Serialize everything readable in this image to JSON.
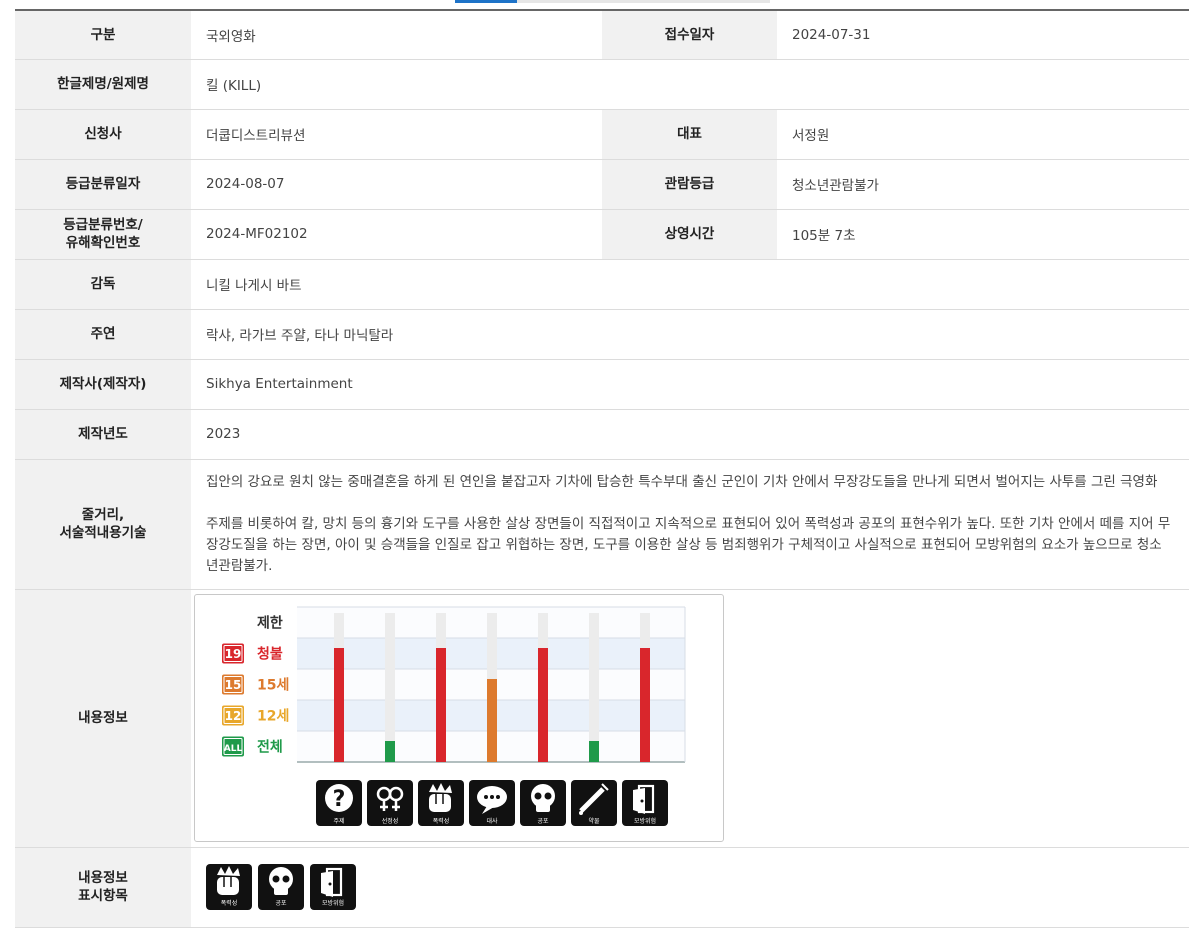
{
  "rows": {
    "category": {
      "label": "구분",
      "value": "국외영화"
    },
    "received": {
      "label": "접수일자",
      "value": "2024-07-31"
    },
    "title": {
      "label": "한글제명/원제명",
      "value": "킬 (KILL)"
    },
    "applicant": {
      "label": "신청사",
      "value": "더쿱디스트리뷰션"
    },
    "representative": {
      "label": "대표",
      "value": "서정원"
    },
    "rating_date": {
      "label": "등급분류일자",
      "value": "2024-08-07"
    },
    "rating": {
      "label": "관람등급",
      "value": "청소년관람불가"
    },
    "rating_no": {
      "label_line1": "등급분류번호/",
      "label_line2": "유해확인번호",
      "value": "2024-MF02102"
    },
    "runtime": {
      "label": "상영시간",
      "value": "105분 7초"
    },
    "director": {
      "label": "감독",
      "value": "니킬 나게시 바트"
    },
    "cast": {
      "label": "주연",
      "value": "락샤, 라가브 주얄, 타나 마닉탈라"
    },
    "producer": {
      "label": "제작사(제작자)",
      "value": "Sikhya Entertainment"
    },
    "year": {
      "label": "제작년도",
      "value": "2023"
    },
    "synopsis": {
      "label_line1": "줄거리,",
      "label_line2": "서술적내용기술",
      "para1": "집안의 강요로 원치 않는 중매결혼을 하게 된 연인을 붙잡고자 기차에 탑승한 특수부대 출신 군인이 기차 안에서 무장강도들을 만나게 되면서 벌어지는 사투를 그린 극영화",
      "para2": "주제를 비롯하여 칼, 망치 등의 흉기와 도구를 사용한 살상 장면들이 직접적이고 지속적으로 표현되어 있어 폭력성과 공포의 표현수위가 높다. 또한 기차 안에서 떼를 지어 무장강도질을 하는 장면, 아이 및 승객들을 인질로 잡고 위협하는 장면, 도구를 이용한 살상 등 범죄행위가 구체적이고 사실적으로 표현되어 모방위험의 요소가 높으므로 청소년관람불가."
    },
    "content_info": {
      "label": "내용정보"
    },
    "display_items": {
      "label_line1": "내용정보",
      "label_line2": "표시항목"
    }
  },
  "levels": [
    {
      "badge": "",
      "name": "제한",
      "color": "#333333"
    },
    {
      "badge": "19",
      "name": "청불",
      "color": "#d9262c"
    },
    {
      "badge": "15",
      "name": "15세",
      "color": "#dd7a2e"
    },
    {
      "badge": "12",
      "name": "12세",
      "color": "#e8a72b"
    },
    {
      "badge": "ALL",
      "name": "전체",
      "color": "#1f9a4a"
    }
  ],
  "chart_data": {
    "type": "bar",
    "categories": [
      "주제",
      "선정성",
      "폭력성",
      "대사",
      "공포",
      "약물",
      "모방위험"
    ],
    "values": [
      "청불",
      "전체",
      "청불",
      "15세",
      "청불",
      "전체",
      "청불"
    ],
    "level_order": [
      "전체",
      "12세",
      "15세",
      "청불",
      "제한"
    ],
    "icons": [
      "question-icon",
      "gender-icon",
      "fist-icon",
      "speech-bubble-icon",
      "skull-icon",
      "syringe-icon",
      "door-icon"
    ]
  },
  "display_icons": [
    {
      "name": "폭력성",
      "icon": "fist-icon"
    },
    {
      "name": "공포",
      "icon": "skull-icon"
    },
    {
      "name": "모방위험",
      "icon": "door-icon"
    }
  ]
}
